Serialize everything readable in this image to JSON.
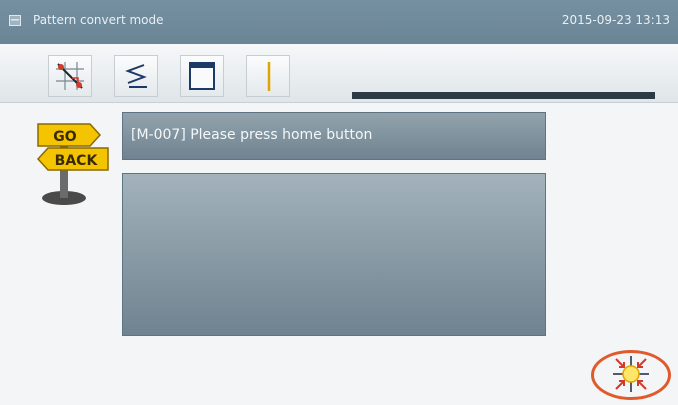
{
  "window": {
    "title": "Pattern convert mode",
    "datetime": "2015-09-23 13:13",
    "icon": "window-icon"
  },
  "toolbar": {
    "buttons": [
      {
        "icon": "pattern-convert-icon"
      },
      {
        "icon": "zigzag-line-icon"
      },
      {
        "icon": "window-frame-icon"
      },
      {
        "icon": "vertical-line-icon"
      }
    ],
    "progress": 1.0
  },
  "sidebar": {
    "go_label": "GO",
    "back_label": "BACK",
    "icon": "go-back-signpost-icon"
  },
  "message": {
    "text": "[M-007] Please press home button"
  },
  "action": {
    "icon": "home-position-icon",
    "highlight_color": "#e05a2c"
  },
  "colors": {
    "titlebar": "#6f899a",
    "panel": "#7f929e",
    "accent_red": "#d23a2a",
    "sign_yellow": "#f5c400"
  }
}
